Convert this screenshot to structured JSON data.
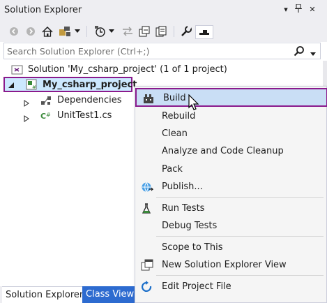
{
  "window": {
    "title": "Solution Explorer",
    "title_buttons": [
      "dropdown-icon",
      "pin-icon",
      "close-icon"
    ]
  },
  "toolbar": {
    "icons": [
      "back-icon",
      "forward-icon",
      "home-icon",
      "switch-views-icon",
      "dropdown-icon",
      "pending-changes-filter-icon",
      "dropdown-icon",
      "sync-icon",
      "collapse-all-icon",
      "show-all-files-icon",
      "properties-icon",
      "preview-icon"
    ]
  },
  "search": {
    "placeholder": "Search Solution Explorer (Ctrl+;)"
  },
  "tree": {
    "solution_label": "Solution 'My_csharp_project' (1 of 1 project)",
    "project_label": "My_csharp_project",
    "children": [
      {
        "label": "Dependencies",
        "icon": "dependencies-icon"
      },
      {
        "label": "UnitTest1.cs",
        "icon": "csharp-file-icon"
      }
    ]
  },
  "context_menu": {
    "items": [
      {
        "label": "Build",
        "icon": "build-icon",
        "highlighted": true
      },
      {
        "label": "Rebuild"
      },
      {
        "label": "Clean"
      },
      {
        "label": "Analyze and Code Cleanup"
      },
      {
        "label": "Pack"
      },
      {
        "label": "Publish...",
        "icon": "publish-icon"
      },
      {
        "label": "Run Tests",
        "icon": "test-icon"
      },
      {
        "label": "Debug Tests"
      },
      {
        "label": "Scope to This"
      },
      {
        "label": "New Solution Explorer View",
        "icon": "new-view-icon"
      },
      {
        "label": "Edit Project File",
        "icon": "edit-refresh-icon"
      }
    ]
  },
  "tabs": {
    "active": "Solution Explorer",
    "inactive": "Class View"
  },
  "colors": {
    "highlight_border": "#8a1a8c",
    "selection_bg": "#cce8ff",
    "menu_hover_bg": "#c9def5",
    "inactive_tab_bg": "#2d6bd0"
  }
}
